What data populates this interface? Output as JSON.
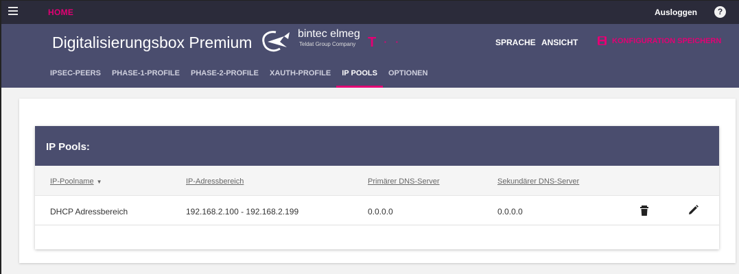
{
  "topbar": {
    "home_label": "HOME",
    "logout_label": "Ausloggen",
    "help_label": "?"
  },
  "header": {
    "title": "Digitalisierungsbox Premium",
    "logo_text": "bintec elmeg",
    "logo_subtext": "Teldat Group Company",
    "telekom_logo": "T",
    "telekom_dots": "• •",
    "language_label": "SPRACHE",
    "view_label": "ANSICHT",
    "save_label": "KONFIGURATION SPEICHERN",
    "accent_color": "#e20074",
    "header_color": "#4a4d6e"
  },
  "tabs": [
    {
      "label": "IPSEC-PEERS"
    },
    {
      "label": "PHASE-1-PROFILE"
    },
    {
      "label": "PHASE-2-PROFILE"
    },
    {
      "label": "XAUTH-PROFILE"
    },
    {
      "label": "IP POOLS",
      "active": true
    },
    {
      "label": "OPTIONEN"
    }
  ],
  "panel": {
    "title": "IP Pools:",
    "columns": [
      "IP-Poolname",
      "IP-Adressbereich",
      "Primärer DNS-Server",
      "Sekundärer DNS-Server"
    ],
    "rows": [
      {
        "name": "DHCP Adressbereich",
        "range": "192.168.2.100 - 192.168.2.199",
        "dns1": "0.0.0.0",
        "dns2": "0.0.0.0",
        "actions": [
          "trash-icon",
          "pencil-icon"
        ]
      }
    ]
  }
}
